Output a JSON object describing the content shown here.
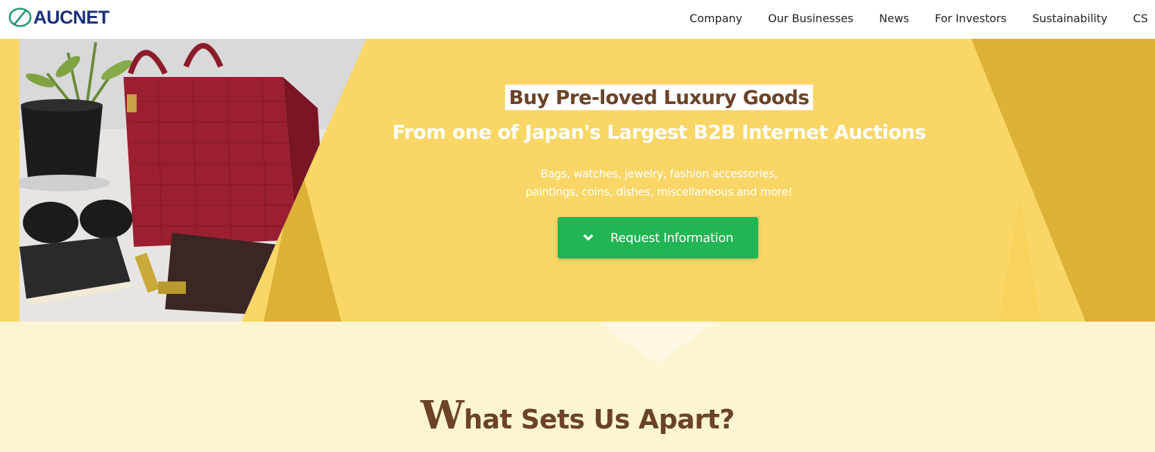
{
  "header": {
    "logo_text": "AUCNET",
    "nav": [
      "Company",
      "Our Businesses",
      "News",
      "For Investors",
      "Sustainability",
      "CS"
    ]
  },
  "hero": {
    "tagline": "Buy Pre-loved Luxury Goods",
    "headline": "From one of Japan's Largest B2B Internet Auctions",
    "sub_line1": "Bags, watches, jewelry, fashion accessories,",
    "sub_line2": "paintings, coins, dishes, miscellaneous and more!",
    "cta_label": "Request Information",
    "cta_icon": "chevron-down-icon"
  },
  "section": {
    "title_initial": "W",
    "title_rest": "hat Sets Us Apart?"
  },
  "colors": {
    "hero_bg": "#f9d666",
    "hero_dark_stripe": "#dcb236",
    "cta": "#22b553",
    "title": "#6b4326",
    "logo": "#1b2f7a",
    "logo_mark": "#1f9a6a",
    "section_bg": "#fcf5d2"
  }
}
